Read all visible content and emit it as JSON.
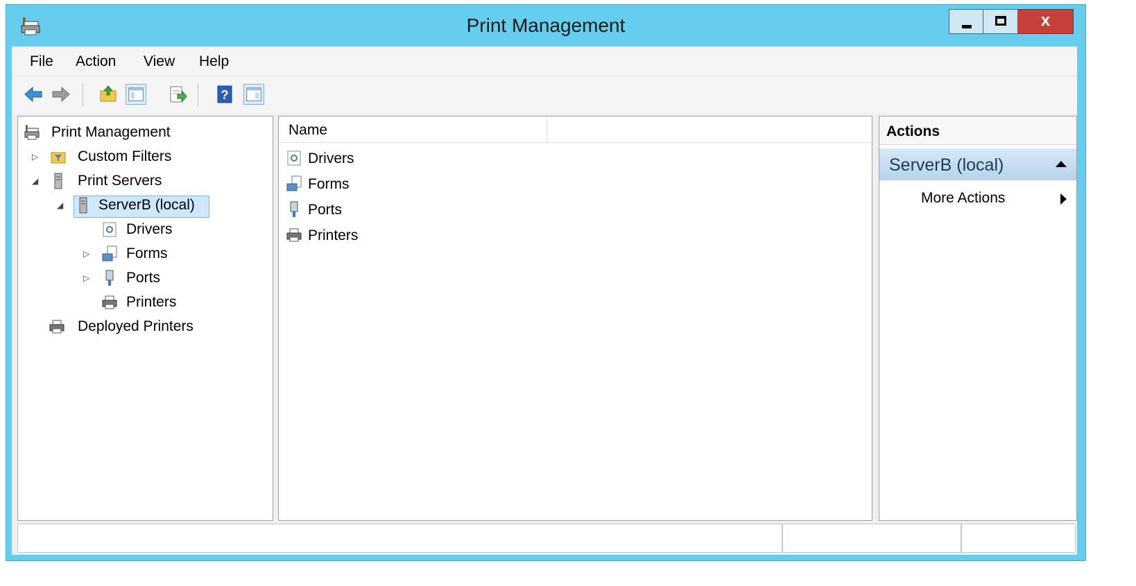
{
  "window": {
    "title": "Print Management"
  },
  "menu": [
    "File",
    "Action",
    "View",
    "Help"
  ],
  "tree": {
    "root": "Print Management",
    "custom_filters": "Custom Filters",
    "print_servers": "Print Servers",
    "server": "ServerB (local)",
    "drivers": "Drivers",
    "forms": "Forms",
    "ports": "Ports",
    "printers": "Printers",
    "deployed": "Deployed Printers"
  },
  "list": {
    "column": "Name",
    "items": [
      "Drivers",
      "Forms",
      "Ports",
      "Printers"
    ]
  },
  "actions": {
    "header": "Actions",
    "section": "ServerB (local)",
    "more": "More Actions"
  },
  "icons": {
    "back": "back-arrow-icon",
    "forward": "forward-arrow-icon",
    "up": "up-folder-icon",
    "console_tree": "show-hide-console-tree-icon",
    "export": "export-list-icon",
    "help": "help-icon",
    "action_pane": "show-hide-action-pane-icon"
  },
  "colors": {
    "titlebar": "#67cdee",
    "close_button": "#c7403a",
    "selection": "#cde8ff",
    "actions_section": "#c3daef"
  }
}
